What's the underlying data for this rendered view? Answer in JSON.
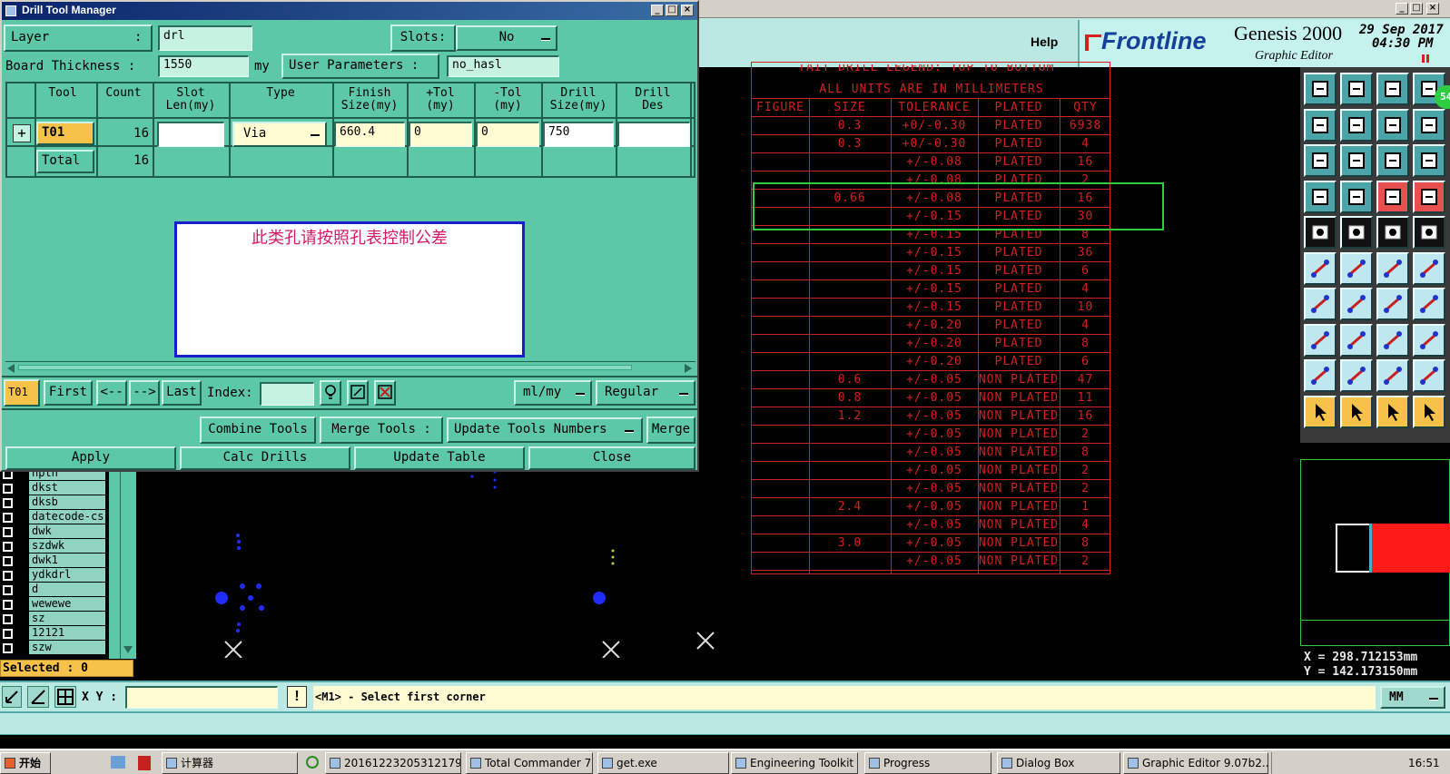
{
  "dialog": {
    "title": "Drill Tool Manager",
    "layer_label": "Layer",
    "layer_colon": ":",
    "layer_value": "drl",
    "slots_label": "Slots:",
    "slots_value": "No",
    "board_thickness_label": "Board Thickness :",
    "board_thickness_value": "1550",
    "board_thickness_unit": "my",
    "user_params_label": "User Parameters :",
    "user_params_value": "no_hasl",
    "table_headers": [
      "Tool",
      "Count",
      "Slot\nLen(my)",
      "Type",
      "Finish\nSize(my)",
      "+Tol\n(my)",
      "-Tol\n(my)",
      "Drill\nSize(my)",
      "Drill\nDes"
    ],
    "row": {
      "expand": "+",
      "tool": "T01",
      "count": "16",
      "slot_len": "",
      "type": "Via",
      "finish": "660.4",
      "ptol": "0",
      "mtol": "0",
      "drill": "750",
      "des": ""
    },
    "total": {
      "label": "Total",
      "count": "16"
    },
    "note": "此类孔请按照孔表控制公差",
    "nav": {
      "current": "T01",
      "first": "First",
      "prev": "<--",
      "next": "-->",
      "last": "Last",
      "index_label": "Index:",
      "index_value": "",
      "units": "ml/my",
      "mode": "Regular"
    },
    "actions": {
      "combine": "Combine Tools",
      "merge_label": "Merge Tools :",
      "update_numbers": "Update Tools Numbers",
      "merge": "Merge",
      "apply": "Apply",
      "calc": "Calc Drills",
      "update_table": "Update Table",
      "close": "Close"
    }
  },
  "editor": {
    "help": "Help",
    "brand": "Frontline",
    "product": "Genesis 2000",
    "subtitle": "Graphic Editor",
    "date": "29 Sep 2017",
    "time": "04:30 PM",
    "badge": "54",
    "coords": {
      "x": "X = 298.712153mm",
      "y": "Y = 142.173150mm"
    },
    "xy_label": "X Y :",
    "xy_value": "",
    "prompt": "<M1> - Select first corner",
    "units": "MM",
    "selected": "Selected : 0"
  },
  "layers": [
    "npth",
    "dkst",
    "dksb",
    "datecode-cs",
    "dwk",
    "szdwk",
    "dwk1",
    "ydkdrl",
    "d",
    "wewewe",
    "sz",
    "12121",
    "szw"
  ],
  "legend": {
    "title": "TAIT DRILL LEGEND: TOP TO BOTTOM",
    "units_note": "ALL UNITS ARE IN MILLIMETERS",
    "headers": [
      "FIGURE",
      "SIZE",
      "TOLERANCE",
      "PLATED",
      "QTY"
    ],
    "rows": [
      [
        "",
        "0.3",
        "+0/-0.30",
        "PLATED",
        "6938"
      ],
      [
        "",
        "0.3",
        "+0/-0.30",
        "PLATED",
        "4"
      ],
      [
        "",
        "",
        "+/-0.08",
        "PLATED",
        "16"
      ],
      [
        "",
        "",
        "+/-0.08",
        "PLATED",
        "2"
      ],
      [
        "",
        "0.66",
        "+/-0.08",
        "PLATED",
        "16"
      ],
      [
        "",
        "",
        "+/-0.15",
        "PLATED",
        "30"
      ],
      [
        "",
        "",
        "+/-0.15",
        "PLATED",
        "8"
      ],
      [
        "",
        "",
        "+/-0.15",
        "PLATED",
        "36"
      ],
      [
        "",
        "",
        "+/-0.15",
        "PLATED",
        "6"
      ],
      [
        "",
        "",
        "+/-0.15",
        "PLATED",
        "4"
      ],
      [
        "",
        "",
        "+/-0.15",
        "PLATED",
        "10"
      ],
      [
        "",
        "",
        "+/-0.20",
        "PLATED",
        "4"
      ],
      [
        "",
        "",
        "+/-0.20",
        "PLATED",
        "8"
      ],
      [
        "",
        "",
        "+/-0.20",
        "PLATED",
        "6"
      ],
      [
        "",
        "0.6",
        "+/-0.05",
        "NON PLATED",
        "47"
      ],
      [
        "",
        "0.8",
        "+/-0.05",
        "NON PLATED",
        "11"
      ],
      [
        "",
        "1.2",
        "+/-0.05",
        "NON PLATED",
        "16"
      ],
      [
        "",
        "",
        "+/-0.05",
        "NON PLATED",
        "2"
      ],
      [
        "",
        "",
        "+/-0.05",
        "NON PLATED",
        "8"
      ],
      [
        "",
        "",
        "+/-0.05",
        "NON PLATED",
        "2"
      ],
      [
        "",
        "",
        "+/-0.05",
        "NON PLATED",
        "2"
      ],
      [
        "",
        "2.4",
        "+/-0.05",
        "NON PLATED",
        "1"
      ],
      [
        "",
        "",
        "+/-0.05",
        "NON PLATED",
        "4"
      ],
      [
        "",
        "3.0",
        "+/-0.05",
        "NON PLATED",
        "8"
      ],
      [
        "",
        "",
        "+/-0.05",
        "NON PLATED",
        "2"
      ]
    ]
  },
  "taskbar": {
    "start": "开始",
    "items": [
      "计算器",
      "20161223205312179...",
      "Total Commander 7.0...",
      "get.exe",
      "Engineering Toolkit 9....",
      "Progress",
      "Dialog Box",
      "Graphic Editor 9.07b2..."
    ],
    "clock": "16:51"
  },
  "colors": {
    "dialog_bg": "#5cc8a6",
    "legend": "#d32020",
    "highlight": "#2ecc40",
    "canvas": "#000000",
    "accent_yellow": "#f6c24a"
  }
}
